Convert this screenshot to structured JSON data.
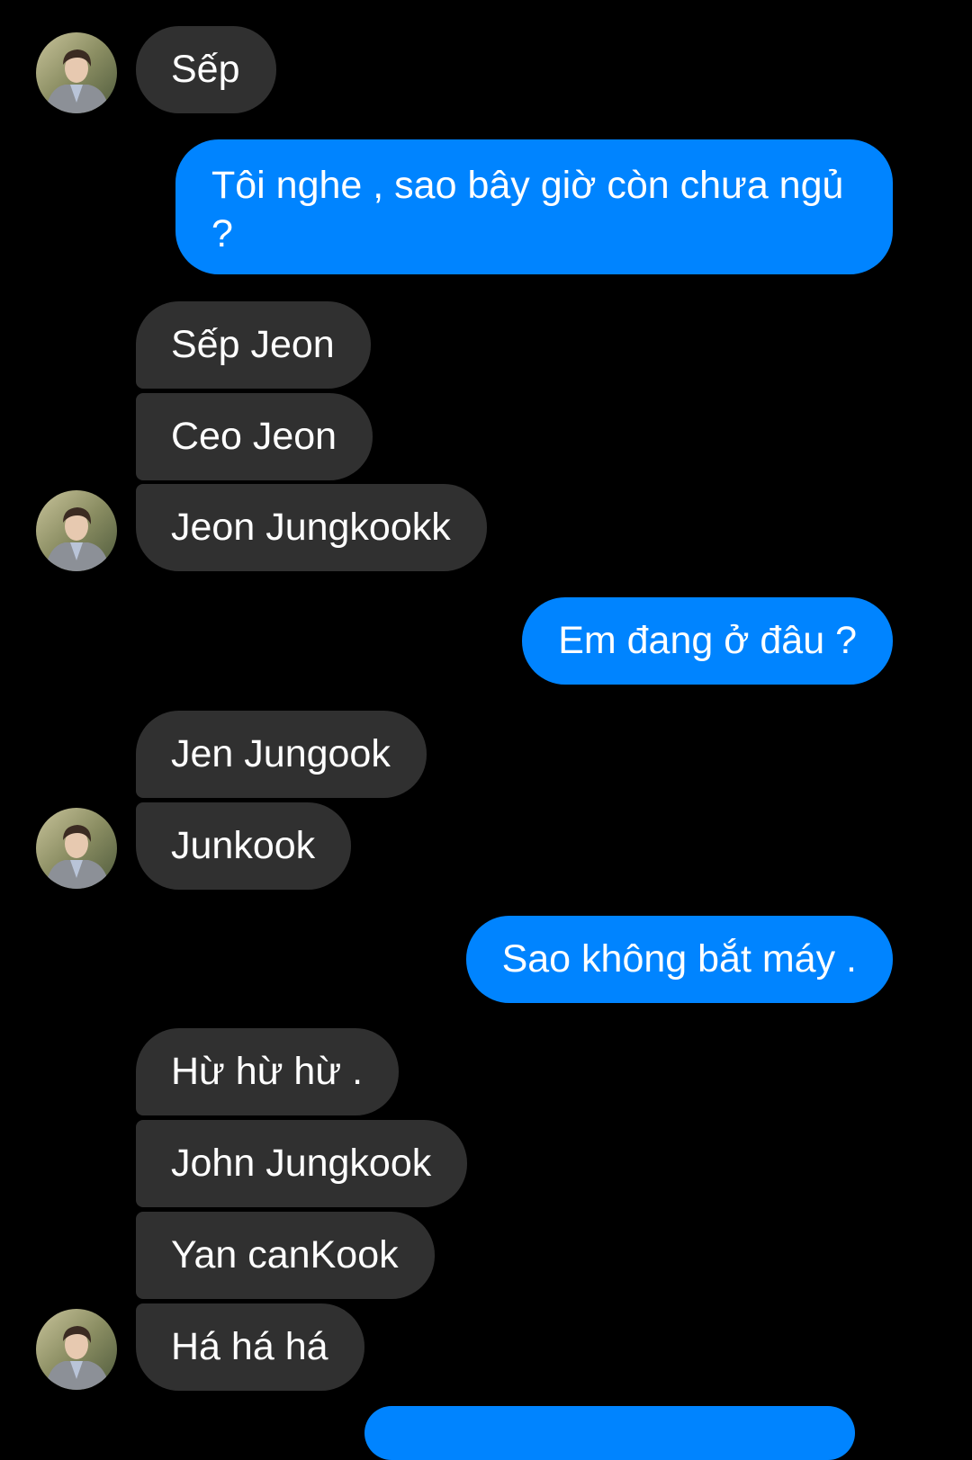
{
  "messages": {
    "m1": "Sếp",
    "m2": "Tôi nghe , sao bây giờ còn chưa ngủ ?",
    "m3": "Sếp Jeon",
    "m4": "Ceo Jeon",
    "m5": "Jeon Jungkookk",
    "m6": "Em đang ở đâu ?",
    "m7": "Jen Jungook",
    "m8": "Junkook",
    "m9": "Sao không bắt máy .",
    "m10": "Hừ hừ hừ .",
    "m11": "John Jungkook",
    "m12": "Yan canKook",
    "m13": "Há há há"
  },
  "colors": {
    "background": "#000000",
    "incoming_bubble": "#303030",
    "outgoing_bubble": "#0084ff",
    "text": "#ffffff"
  },
  "icons": {
    "avatar": "contact-avatar-photo"
  }
}
